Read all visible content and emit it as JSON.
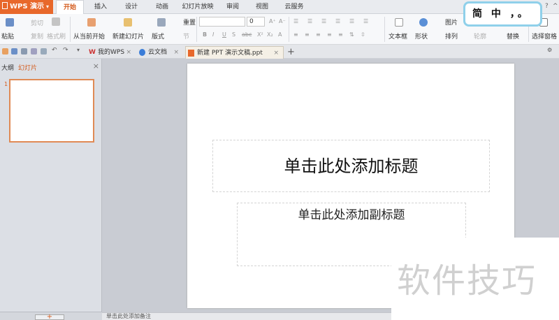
{
  "app": {
    "name": "WPS 演示"
  },
  "menu": {
    "tabs": [
      "开始",
      "插入",
      "设计",
      "动画",
      "幻灯片放映",
      "审阅",
      "视图",
      "云服务"
    ],
    "active": "开始"
  },
  "ribbon": {
    "paste": "粘贴",
    "cut": "剪切",
    "copy": "复制",
    "format_painter": "格式刷",
    "from_current": "从当前开始",
    "new_slide": "新建幻灯片",
    "layout": "版式",
    "reset": "重置",
    "section": "节",
    "font_size": "0",
    "textbox": "文本框",
    "shape": "形状",
    "picture": "图片",
    "arrange": "排列",
    "outline": "轮廓",
    "replace": "替换",
    "select_pane": "选择窗格"
  },
  "tabs": {
    "items": [
      {
        "label": "我的WPS"
      },
      {
        "label": "云文档"
      },
      {
        "label": "新建 PPT 演示文稿.ppt"
      }
    ]
  },
  "left_pane": {
    "outline_tab": "大纲",
    "slides_tab": "幻灯片",
    "slide_number": "1"
  },
  "slide": {
    "title_placeholder": "单击此处添加标题",
    "subtitle_placeholder": "单击此处添加副标题"
  },
  "notes": {
    "placeholder": "单击此处添加备注"
  },
  "ime": {
    "text": "简 中 ，。"
  },
  "watermark": {
    "text": "软件技巧"
  },
  "colors": {
    "accent": "#e8682b",
    "tab_active": "#d45c1e",
    "ime_border": "#8fd0ea"
  }
}
